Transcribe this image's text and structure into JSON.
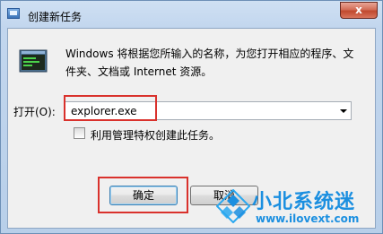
{
  "window": {
    "title": "创建新任务",
    "close_label": "x"
  },
  "dialog": {
    "description": "Windows 将根据您所输入的名称，为您打开相应的程序、文件夹、文档或 Internet 资源。",
    "open_label": "打开(O):",
    "open_value": "explorer.exe",
    "admin_checkbox_label": "利用管理特权创建此任务。",
    "admin_checked": false,
    "ok_label": "确定",
    "cancel_label": "取消",
    "icons": [
      "app-icon",
      "run-program-icon",
      "dropdown-arrow-icon"
    ]
  },
  "watermark": {
    "brand": "小北系统迷",
    "url": "www.ilovext.com",
    "colors": [
      "#1b8fe0",
      "#2aa8f0"
    ]
  },
  "colors": {
    "highlight": "#d9312c",
    "close_button": "#c0492e",
    "titlebar": "#c2d6ee"
  }
}
